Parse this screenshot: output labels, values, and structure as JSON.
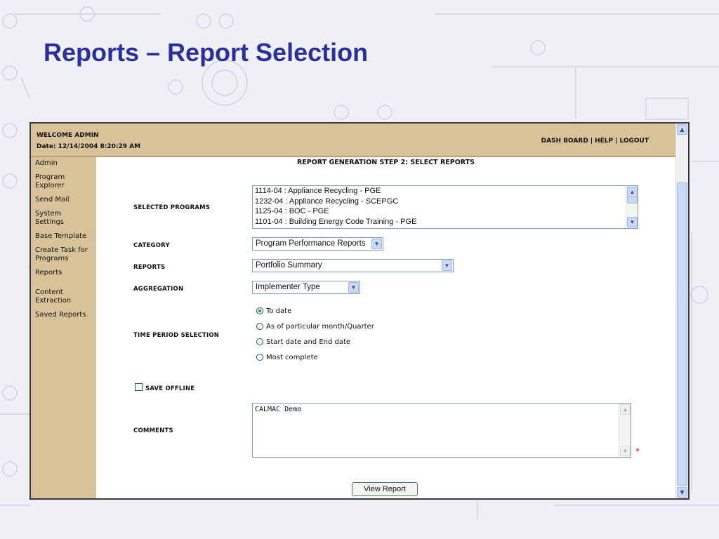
{
  "slide": {
    "title": "Reports – Report Selection"
  },
  "header": {
    "welcome": "WELCOME ADMIN",
    "date": "Date: 12/14/2004 8:20:29 AM",
    "links": [
      "DASH BOARD",
      "HELP",
      "LOGOUT"
    ],
    "separator": "|"
  },
  "sidebar": {
    "items": [
      {
        "label": "Admin"
      },
      {
        "label": "Program Explorer"
      },
      {
        "label": "Send Mail"
      },
      {
        "label": "System Settings"
      },
      {
        "label": "Base Template"
      },
      {
        "label": "Create Task for Programs"
      },
      {
        "label": "Reports"
      },
      {
        "label": "Content Extraction"
      },
      {
        "label": "Saved Reports"
      }
    ]
  },
  "form": {
    "step_title": "REPORT GENERATION STEP 2: SELECT REPORTS",
    "selected_programs": {
      "label": "SELECTED PROGRAMS",
      "options": [
        "1114-04 : Appliance Recycling - PGE",
        "1232-04 : Appliance Recycling - SCEPGC",
        "1125-04 : BOC - PGE",
        "1101-04 : Building Energy Code Training - PGE"
      ]
    },
    "category": {
      "label": "CATEGORY",
      "value": "Program Performance Reports"
    },
    "reports": {
      "label": "REPORTS",
      "value": "Portfolio Summary"
    },
    "aggregation": {
      "label": "AGGREGATION",
      "value": "Implementer Type"
    },
    "time_period": {
      "label": "TIME PERIOD SELECTION",
      "options": [
        {
          "label": "To date",
          "selected": true
        },
        {
          "label": "As of particular month/Quarter",
          "selected": false
        },
        {
          "label": "Start date and End date",
          "selected": false
        },
        {
          "label": "Most complete",
          "selected": false
        }
      ]
    },
    "save_offline": {
      "label": "SAVE OFFLINE",
      "checked": false
    },
    "comments": {
      "label": "COMMENTS",
      "value": "CALMAC Demo",
      "required_mark": "*"
    },
    "submit_label": "View Report"
  },
  "icons": {
    "scroll_up": "chevron-up-icon",
    "scroll_down": "chevron-down-icon",
    "dropdown": "chevron-down-icon"
  },
  "colors": {
    "title": "#2a2f9c",
    "header_bg": "#d8c29a",
    "radio_selected": "#21a121",
    "required": "#dd0000"
  }
}
